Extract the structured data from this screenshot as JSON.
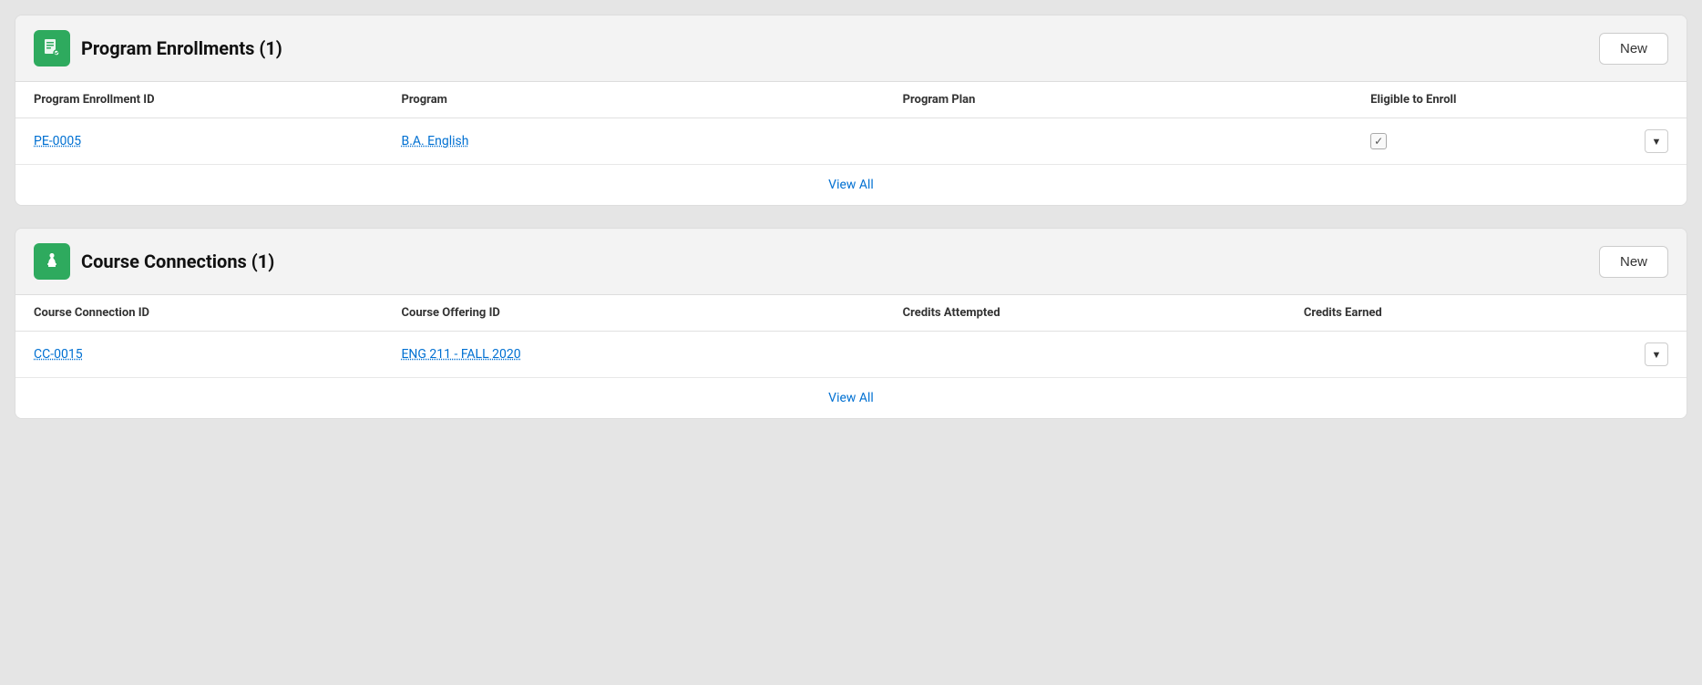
{
  "program_enrollments": {
    "title": "Program Enrollments (1)",
    "new_button": "New",
    "icon_label": "program-enrollments-icon",
    "columns": [
      {
        "key": "id",
        "label": "Program Enrollment ID"
      },
      {
        "key": "program",
        "label": "Program"
      },
      {
        "key": "plan",
        "label": "Program Plan"
      },
      {
        "key": "eligible",
        "label": "Eligible to Enroll"
      }
    ],
    "rows": [
      {
        "id": "PE-0005",
        "program": "B.A. English",
        "plan": "",
        "eligible_checked": true
      }
    ],
    "view_all": "View All"
  },
  "course_connections": {
    "title": "Course Connections (1)",
    "new_button": "New",
    "icon_label": "course-connections-icon",
    "columns": [
      {
        "key": "id",
        "label": "Course Connection ID"
      },
      {
        "key": "offering",
        "label": "Course Offering ID"
      },
      {
        "key": "attempted",
        "label": "Credits Attempted"
      },
      {
        "key": "earned",
        "label": "Credits Earned"
      }
    ],
    "rows": [
      {
        "id": "CC-0015",
        "offering": "ENG 211 - FALL 2020",
        "attempted": "",
        "earned": ""
      }
    ],
    "view_all": "View All"
  }
}
